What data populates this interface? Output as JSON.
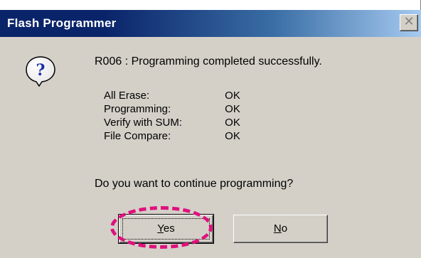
{
  "window": {
    "title": "Flash Programmer",
    "close_glyph": "✕"
  },
  "dialog": {
    "icon": "question-icon",
    "message": "R006 : Programming completed successfully.",
    "results": [
      {
        "label": "All Erase:",
        "value": "OK"
      },
      {
        "label": "Programming:",
        "value": "OK"
      },
      {
        "label": "Verify with SUM:",
        "value": "OK"
      },
      {
        "label": "File Compare:",
        "value": "OK"
      }
    ],
    "question": "Do you want to continue programming?"
  },
  "buttons": {
    "yes_mnemonic": "Y",
    "yes_rest": "es",
    "no_mnemonic": "N",
    "no_rest": "o"
  },
  "colors": {
    "title_bar_start": "#0a246a",
    "title_bar_end": "#a6caf0",
    "dialog_face": "#d4d0c8",
    "highlight_ring": "#e0107e"
  }
}
